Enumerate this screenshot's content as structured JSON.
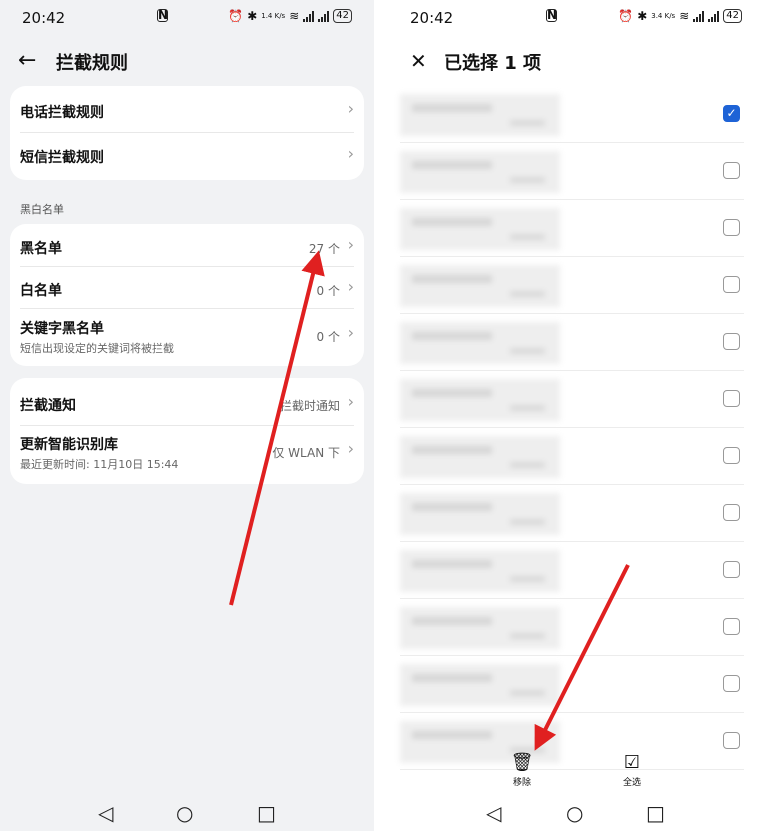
{
  "left": {
    "status": {
      "time": "20:42",
      "speed": "1.4 K/s",
      "battery": "42"
    },
    "title": "拦截规则",
    "card1": [
      {
        "label": "电话拦截规则"
      },
      {
        "label": "短信拦截规则"
      }
    ],
    "section_label": "黑白名单",
    "card2": [
      {
        "label": "黑名单",
        "value": "27 个"
      },
      {
        "label": "白名单",
        "value": "0 个"
      },
      {
        "label": "关键字黑名单",
        "sub": "短信出现设定的关键词将被拦截",
        "value": "0 个"
      }
    ],
    "card3": [
      {
        "label": "拦截通知",
        "value": "拦截时通知"
      },
      {
        "label": "更新智能识别库",
        "sub": "最近更新时间: 11月10日 15:44",
        "value": "仅 WLAN 下"
      }
    ]
  },
  "right": {
    "status": {
      "time": "20:42",
      "speed": "3.4 K/s",
      "battery": "42"
    },
    "title": "已选择 1 项",
    "items_checked": [
      true,
      false,
      false,
      false,
      false,
      false,
      false,
      false,
      false,
      false,
      false,
      false
    ],
    "actions": {
      "remove": "移除",
      "select_all": "全选"
    }
  },
  "colors": {
    "accent": "#1e63d6",
    "arrow": "#e02020"
  }
}
